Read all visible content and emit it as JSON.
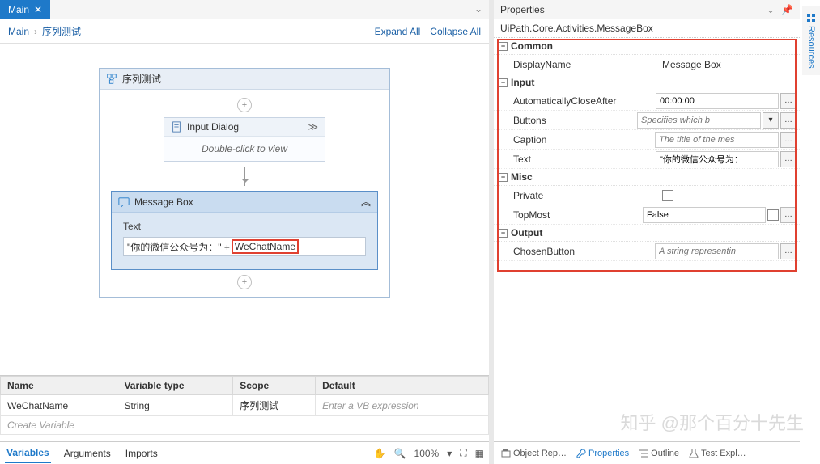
{
  "tabs": {
    "main_label": "Main"
  },
  "breadcrumb": {
    "root": "Main",
    "child": "序列测试",
    "expand_all": "Expand All",
    "collapse_all": "Collapse All"
  },
  "sequence": {
    "title": "序列测试"
  },
  "input_dialog": {
    "title": "Input Dialog",
    "hint": "Double-click to view"
  },
  "msgbox": {
    "title": "Message Box",
    "text_label": "Text",
    "expr_prefix": "\"你的微信公众号为：\" +",
    "expr_highlight": "WeChatName"
  },
  "variables": {
    "headers": {
      "name": "Name",
      "type": "Variable type",
      "scope": "Scope",
      "default": "Default"
    },
    "rows": [
      {
        "name": "WeChatName",
        "type": "String",
        "scope": "序列测试",
        "default_placeholder": "Enter a VB expression"
      }
    ],
    "create_label": "Create Variable"
  },
  "bottom_tabs": {
    "variables": "Variables",
    "arguments": "Arguments",
    "imports": "Imports",
    "zoom": "100%"
  },
  "properties": {
    "panel_title": "Properties",
    "type_name": "UiPath.Core.Activities.MessageBox",
    "categories": {
      "common": "Common",
      "input": "Input",
      "misc": "Misc",
      "output": "Output"
    },
    "rows": {
      "display_name": {
        "label": "DisplayName",
        "value": "Message Box"
      },
      "auto_close": {
        "label": "AutomaticallyCloseAfter",
        "value": "00:00:00"
      },
      "buttons": {
        "label": "Buttons",
        "placeholder": "Specifies which b"
      },
      "caption": {
        "label": "Caption",
        "placeholder": "The title of the mes"
      },
      "text": {
        "label": "Text",
        "value": "\"你的微信公众号为："
      },
      "private": {
        "label": "Private"
      },
      "topmost": {
        "label": "TopMost",
        "value": "False"
      },
      "chosen": {
        "label": "ChosenButton",
        "placeholder": "A string representin"
      }
    }
  },
  "props_bottom": {
    "object_repo": "Object Rep…",
    "properties": "Properties",
    "outline": "Outline",
    "test_expl": "Test Expl…"
  },
  "side": {
    "resources": "Resources"
  },
  "watermark": "知乎 @那个百分十先生"
}
